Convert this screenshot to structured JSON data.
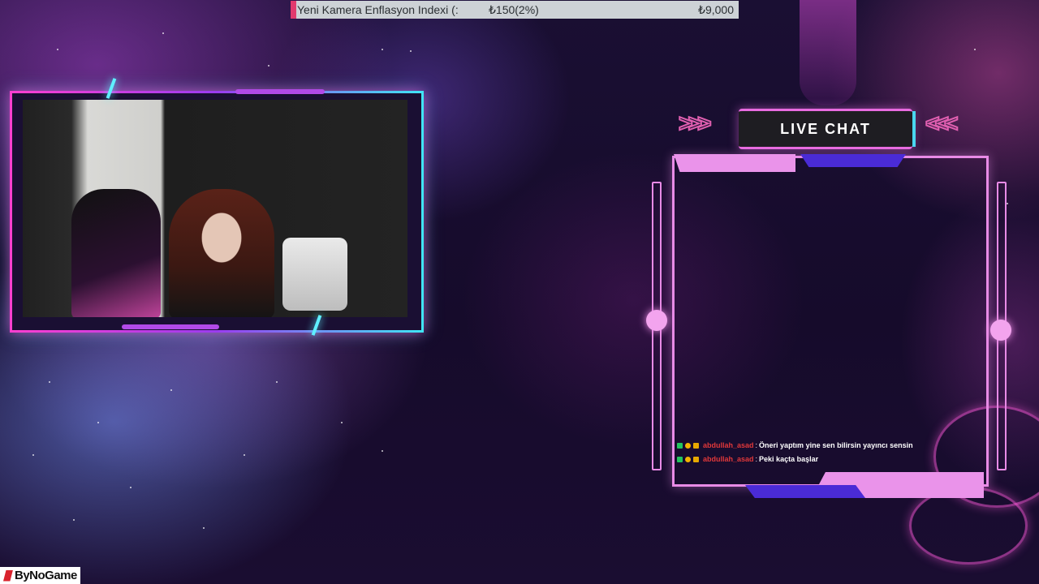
{
  "ticker": {
    "name": "Yeni Kamera Enflasyon Indexi (:",
    "change": "₺150(2%)",
    "total": "₺9,000",
    "accent_color": "#e23a6e"
  },
  "chat": {
    "title": "LIVE CHAT",
    "messages": [
      {
        "badges": [
          "mod-icon",
          "one-icon",
          "sub-icon"
        ],
        "user": "abdullah_asad",
        "separator": ":",
        "text": "Öneri yaptım yine sen bilirsin yayıncı sensin"
      },
      {
        "badges": [
          "mod-icon",
          "one-icon",
          "sub-icon"
        ],
        "user": "abdullah_asad",
        "separator": ":",
        "text": "Peki kaçta başlar"
      }
    ]
  },
  "logo": {
    "text": "ByNoGame"
  },
  "colors": {
    "frame_pink": "#e88be6",
    "frame_blue": "#4a2bd6",
    "cyan": "#3fe6f5",
    "username": "#e0383a"
  }
}
